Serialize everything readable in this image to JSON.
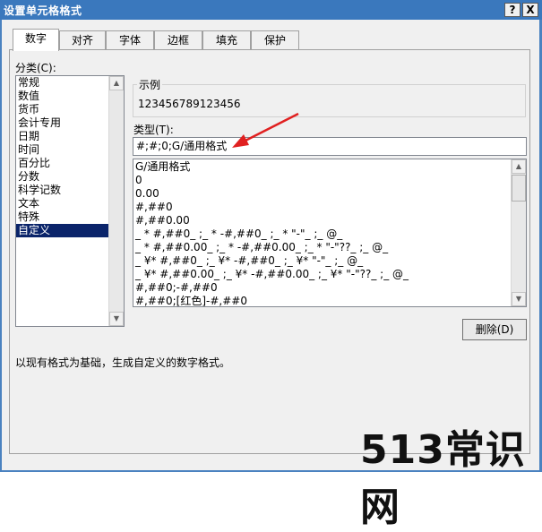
{
  "window": {
    "title": "设置单元格格式",
    "help_button": "?",
    "close_button": "X"
  },
  "tabs": [
    {
      "label": "数字",
      "active": true
    },
    {
      "label": "对齐"
    },
    {
      "label": "字体"
    },
    {
      "label": "边框"
    },
    {
      "label": "填充"
    },
    {
      "label": "保护"
    }
  ],
  "category": {
    "label": "分类(C):",
    "items": [
      "常规",
      "数值",
      "货币",
      "会计专用",
      "日期",
      "时间",
      "百分比",
      "分数",
      "科学记数",
      "文本",
      "特殊",
      "自定义"
    ],
    "selected": "自定义"
  },
  "sample": {
    "label": "示例",
    "value": "123456789123456"
  },
  "type": {
    "label": "类型(T):",
    "value": "#;#;0;G/通用格式"
  },
  "formats": [
    "G/通用格式",
    "0",
    "0.00",
    "#,##0",
    "#,##0.00",
    "_ * #,##0_ ;_ * -#,##0_ ;_ * \"-\"_ ;_ @_",
    "_ * #,##0.00_ ;_ * -#,##0.00_ ;_ * \"-\"??_ ;_ @_",
    "_ ¥* #,##0_ ;_ ¥* -#,##0_ ;_ ¥* \"-\"_ ;_ @_",
    "_ ¥* #,##0.00_ ;_ ¥* -#,##0.00_ ;_ ¥* \"-\"??_ ;_ @_",
    "#,##0;-#,##0",
    "#,##0;[红色]-#,##0"
  ],
  "delete_button": "删除(D)",
  "description": "以现有格式为基础，生成自定义的数字格式。",
  "watermark": "513常识网",
  "colors": {
    "titlebar": "#3a78bd",
    "selection": "#0a246a",
    "annotation_arrow": "#e02020"
  }
}
